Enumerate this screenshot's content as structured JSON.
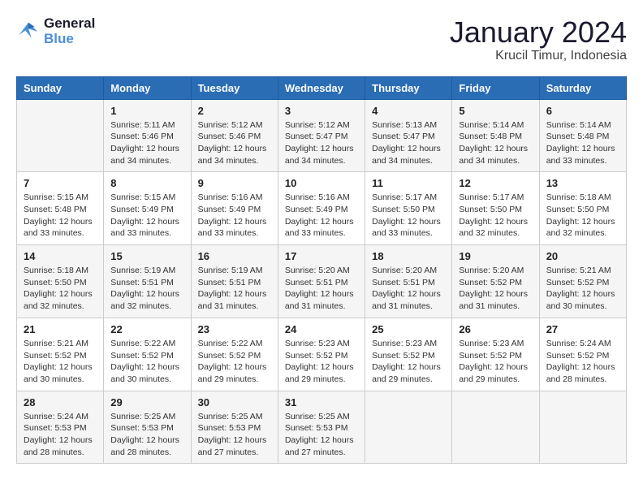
{
  "header": {
    "logo_line1": "General",
    "logo_line2": "Blue",
    "month": "January 2024",
    "location": "Krucil Timur, Indonesia"
  },
  "days_of_week": [
    "Sunday",
    "Monday",
    "Tuesday",
    "Wednesday",
    "Thursday",
    "Friday",
    "Saturday"
  ],
  "weeks": [
    [
      {
        "day": "",
        "info": ""
      },
      {
        "day": "1",
        "info": "Sunrise: 5:11 AM\nSunset: 5:46 PM\nDaylight: 12 hours\nand 34 minutes."
      },
      {
        "day": "2",
        "info": "Sunrise: 5:12 AM\nSunset: 5:46 PM\nDaylight: 12 hours\nand 34 minutes."
      },
      {
        "day": "3",
        "info": "Sunrise: 5:12 AM\nSunset: 5:47 PM\nDaylight: 12 hours\nand 34 minutes."
      },
      {
        "day": "4",
        "info": "Sunrise: 5:13 AM\nSunset: 5:47 PM\nDaylight: 12 hours\nand 34 minutes."
      },
      {
        "day": "5",
        "info": "Sunrise: 5:14 AM\nSunset: 5:48 PM\nDaylight: 12 hours\nand 34 minutes."
      },
      {
        "day": "6",
        "info": "Sunrise: 5:14 AM\nSunset: 5:48 PM\nDaylight: 12 hours\nand 33 minutes."
      }
    ],
    [
      {
        "day": "7",
        "info": "Sunrise: 5:15 AM\nSunset: 5:48 PM\nDaylight: 12 hours\nand 33 minutes."
      },
      {
        "day": "8",
        "info": "Sunrise: 5:15 AM\nSunset: 5:49 PM\nDaylight: 12 hours\nand 33 minutes."
      },
      {
        "day": "9",
        "info": "Sunrise: 5:16 AM\nSunset: 5:49 PM\nDaylight: 12 hours\nand 33 minutes."
      },
      {
        "day": "10",
        "info": "Sunrise: 5:16 AM\nSunset: 5:49 PM\nDaylight: 12 hours\nand 33 minutes."
      },
      {
        "day": "11",
        "info": "Sunrise: 5:17 AM\nSunset: 5:50 PM\nDaylight: 12 hours\nand 33 minutes."
      },
      {
        "day": "12",
        "info": "Sunrise: 5:17 AM\nSunset: 5:50 PM\nDaylight: 12 hours\nand 32 minutes."
      },
      {
        "day": "13",
        "info": "Sunrise: 5:18 AM\nSunset: 5:50 PM\nDaylight: 12 hours\nand 32 minutes."
      }
    ],
    [
      {
        "day": "14",
        "info": "Sunrise: 5:18 AM\nSunset: 5:50 PM\nDaylight: 12 hours\nand 32 minutes."
      },
      {
        "day": "15",
        "info": "Sunrise: 5:19 AM\nSunset: 5:51 PM\nDaylight: 12 hours\nand 32 minutes."
      },
      {
        "day": "16",
        "info": "Sunrise: 5:19 AM\nSunset: 5:51 PM\nDaylight: 12 hours\nand 31 minutes."
      },
      {
        "day": "17",
        "info": "Sunrise: 5:20 AM\nSunset: 5:51 PM\nDaylight: 12 hours\nand 31 minutes."
      },
      {
        "day": "18",
        "info": "Sunrise: 5:20 AM\nSunset: 5:51 PM\nDaylight: 12 hours\nand 31 minutes."
      },
      {
        "day": "19",
        "info": "Sunrise: 5:20 AM\nSunset: 5:52 PM\nDaylight: 12 hours\nand 31 minutes."
      },
      {
        "day": "20",
        "info": "Sunrise: 5:21 AM\nSunset: 5:52 PM\nDaylight: 12 hours\nand 30 minutes."
      }
    ],
    [
      {
        "day": "21",
        "info": "Sunrise: 5:21 AM\nSunset: 5:52 PM\nDaylight: 12 hours\nand 30 minutes."
      },
      {
        "day": "22",
        "info": "Sunrise: 5:22 AM\nSunset: 5:52 PM\nDaylight: 12 hours\nand 30 minutes."
      },
      {
        "day": "23",
        "info": "Sunrise: 5:22 AM\nSunset: 5:52 PM\nDaylight: 12 hours\nand 29 minutes."
      },
      {
        "day": "24",
        "info": "Sunrise: 5:23 AM\nSunset: 5:52 PM\nDaylight: 12 hours\nand 29 minutes."
      },
      {
        "day": "25",
        "info": "Sunrise: 5:23 AM\nSunset: 5:52 PM\nDaylight: 12 hours\nand 29 minutes."
      },
      {
        "day": "26",
        "info": "Sunrise: 5:23 AM\nSunset: 5:52 PM\nDaylight: 12 hours\nand 29 minutes."
      },
      {
        "day": "27",
        "info": "Sunrise: 5:24 AM\nSunset: 5:52 PM\nDaylight: 12 hours\nand 28 minutes."
      }
    ],
    [
      {
        "day": "28",
        "info": "Sunrise: 5:24 AM\nSunset: 5:53 PM\nDaylight: 12 hours\nand 28 minutes."
      },
      {
        "day": "29",
        "info": "Sunrise: 5:25 AM\nSunset: 5:53 PM\nDaylight: 12 hours\nand 28 minutes."
      },
      {
        "day": "30",
        "info": "Sunrise: 5:25 AM\nSunset: 5:53 PM\nDaylight: 12 hours\nand 27 minutes."
      },
      {
        "day": "31",
        "info": "Sunrise: 5:25 AM\nSunset: 5:53 PM\nDaylight: 12 hours\nand 27 minutes."
      },
      {
        "day": "",
        "info": ""
      },
      {
        "day": "",
        "info": ""
      },
      {
        "day": "",
        "info": ""
      }
    ]
  ]
}
